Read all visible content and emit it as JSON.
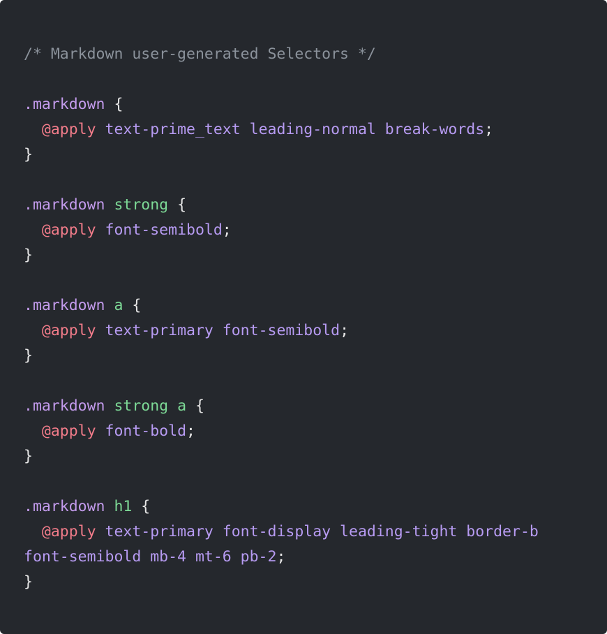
{
  "colors": {
    "background": "#25282d",
    "comment": "#8b929b",
    "class_selector": "#c39bec",
    "tag_selector": "#7dd996",
    "at_rule": "#f27c8a",
    "utility": "#b79bf2",
    "punctuation": "#e6e6e6"
  },
  "code": {
    "lines": [
      [
        {
          "type": "comment",
          "text": "/* Markdown user-generated Selectors */"
        }
      ],
      [],
      [
        {
          "type": "class",
          "text": ".markdown"
        },
        {
          "type": "punct",
          "text": " {"
        }
      ],
      [
        {
          "type": "punct",
          "text": "  "
        },
        {
          "type": "at",
          "text": "@apply"
        },
        {
          "type": "punct",
          "text": " "
        },
        {
          "type": "utility",
          "text": "text-prime_text leading-normal break-words"
        },
        {
          "type": "punct",
          "text": ";"
        }
      ],
      [
        {
          "type": "punct",
          "text": "}"
        }
      ],
      [],
      [
        {
          "type": "class",
          "text": ".markdown"
        },
        {
          "type": "punct",
          "text": " "
        },
        {
          "type": "tag",
          "text": "strong"
        },
        {
          "type": "punct",
          "text": " {"
        }
      ],
      [
        {
          "type": "punct",
          "text": "  "
        },
        {
          "type": "at",
          "text": "@apply"
        },
        {
          "type": "punct",
          "text": " "
        },
        {
          "type": "utility",
          "text": "font-semibold"
        },
        {
          "type": "punct",
          "text": ";"
        }
      ],
      [
        {
          "type": "punct",
          "text": "}"
        }
      ],
      [],
      [
        {
          "type": "class",
          "text": ".markdown"
        },
        {
          "type": "punct",
          "text": " "
        },
        {
          "type": "tag",
          "text": "a"
        },
        {
          "type": "punct",
          "text": " {"
        }
      ],
      [
        {
          "type": "punct",
          "text": "  "
        },
        {
          "type": "at",
          "text": "@apply"
        },
        {
          "type": "punct",
          "text": " "
        },
        {
          "type": "utility",
          "text": "text-primary font-semibold"
        },
        {
          "type": "punct",
          "text": ";"
        }
      ],
      [
        {
          "type": "punct",
          "text": "}"
        }
      ],
      [],
      [
        {
          "type": "class",
          "text": ".markdown"
        },
        {
          "type": "punct",
          "text": " "
        },
        {
          "type": "tag",
          "text": "strong"
        },
        {
          "type": "punct",
          "text": " "
        },
        {
          "type": "tag",
          "text": "a"
        },
        {
          "type": "punct",
          "text": " {"
        }
      ],
      [
        {
          "type": "punct",
          "text": "  "
        },
        {
          "type": "at",
          "text": "@apply"
        },
        {
          "type": "punct",
          "text": " "
        },
        {
          "type": "utility",
          "text": "font-bold"
        },
        {
          "type": "punct",
          "text": ";"
        }
      ],
      [
        {
          "type": "punct",
          "text": "}"
        }
      ],
      [],
      [
        {
          "type": "class",
          "text": ".markdown"
        },
        {
          "type": "punct",
          "text": " "
        },
        {
          "type": "tag",
          "text": "h1"
        },
        {
          "type": "punct",
          "text": " {"
        }
      ],
      [
        {
          "type": "punct",
          "text": "  "
        },
        {
          "type": "at",
          "text": "@apply"
        },
        {
          "type": "punct",
          "text": " "
        },
        {
          "type": "utility",
          "text": "text-primary font-display leading-tight border-b"
        }
      ],
      [
        {
          "type": "utility",
          "text": "font-semibold mb-4 mt-6 pb-2"
        },
        {
          "type": "punct",
          "text": ";"
        }
      ],
      [
        {
          "type": "punct",
          "text": "}"
        }
      ]
    ]
  }
}
